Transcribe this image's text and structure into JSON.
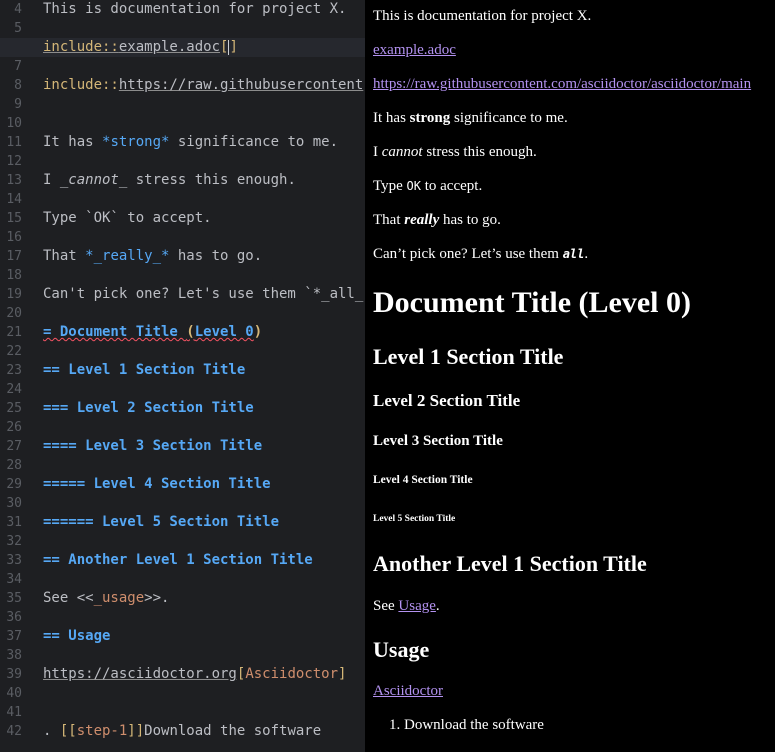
{
  "editor": {
    "line_numbers": [
      "4",
      "5",
      "6",
      "7",
      "8",
      "9",
      "10",
      "11",
      "12",
      "13",
      "14",
      "15",
      "16",
      "17",
      "18",
      "19",
      "20",
      "21",
      "22",
      "23",
      "24",
      "25",
      "26",
      "27",
      "28",
      "29",
      "30",
      "31",
      "32",
      "33",
      "34",
      "35",
      "36",
      "37",
      "38",
      "39",
      "40",
      "41",
      "42"
    ],
    "l4": "This is documentation for project X.",
    "l6_kw": "include::",
    "l6_target": "example.adoc",
    "l6_open": "[",
    "l6_close": "]",
    "l8_kw": "include::",
    "l8_target": "https://raw.githubusercontent",
    "l11_a": "It has ",
    "l11_b": "*strong*",
    "l11_c": " significance to me.",
    "l13_a": "I ",
    "l13_b": "_cannot_",
    "l13_c": " stress this enough.",
    "l15": "Type `OK` to accept.",
    "l17_a": "That ",
    "l17_b": "*_really_*",
    "l17_c": " has to go.",
    "l19": "Can't pick one? Let's use them `*_all_",
    "l21_a": "= Document Title ",
    "l21_b": "(",
    "l21_c": "Level 0",
    "l21_d": ")",
    "l23": "== Level 1 Section Title",
    "l25": "=== Level 2 Section Title",
    "l27": "==== Level 3 Section Title",
    "l29": "===== Level 4 Section Title",
    "l31": "====== Level 5 Section Title",
    "l33": "== Another Level 1 Section Title",
    "l35_a": "See <<",
    "l35_b": "_usage",
    "l35_c": ">>.",
    "l37": "== Usage",
    "l39_a": "https://asciidoctor.org",
    "l39_b": "[",
    "l39_c": "Asciidoctor",
    "l39_d": "]",
    "l42_a": ". ",
    "l42_b": "[[",
    "l42_c": "step-1",
    "l42_d": "]]",
    "l42_e": "Download the software"
  },
  "preview": {
    "intro": "This is documentation for project X.",
    "link1": "example.adoc",
    "link2": "https://raw.githubusercontent.com/asciidoctor/asciidoctor/main",
    "strong_a": "It has ",
    "strong_b": "strong",
    "strong_c": " significance to me.",
    "cannot_a": "I ",
    "cannot_b": "cannot",
    "cannot_c": " stress this enough.",
    "ok_a": "Type ",
    "ok_b": "OK",
    "ok_c": " to accept.",
    "really_a": "That ",
    "really_b": "really",
    "really_c": " has to go.",
    "all_a": "Can’t pick one? Let’s use them ",
    "all_b": "all",
    "all_c": ".",
    "h0": "Document Title (Level 0)",
    "h1": "Level 1 Section Title",
    "h2": "Level 2 Section Title",
    "h3": "Level 3 Section Title",
    "h4": "Level 4 Section Title",
    "h5": "Level 5 Section Title",
    "h1b": "Another Level 1 Section Title",
    "see_a": "See ",
    "see_b": "Usage",
    "see_c": ".",
    "usage": "Usage",
    "asciidoctor": "Asciidoctor",
    "list_num": "1.",
    "list_item": "Download the software"
  }
}
